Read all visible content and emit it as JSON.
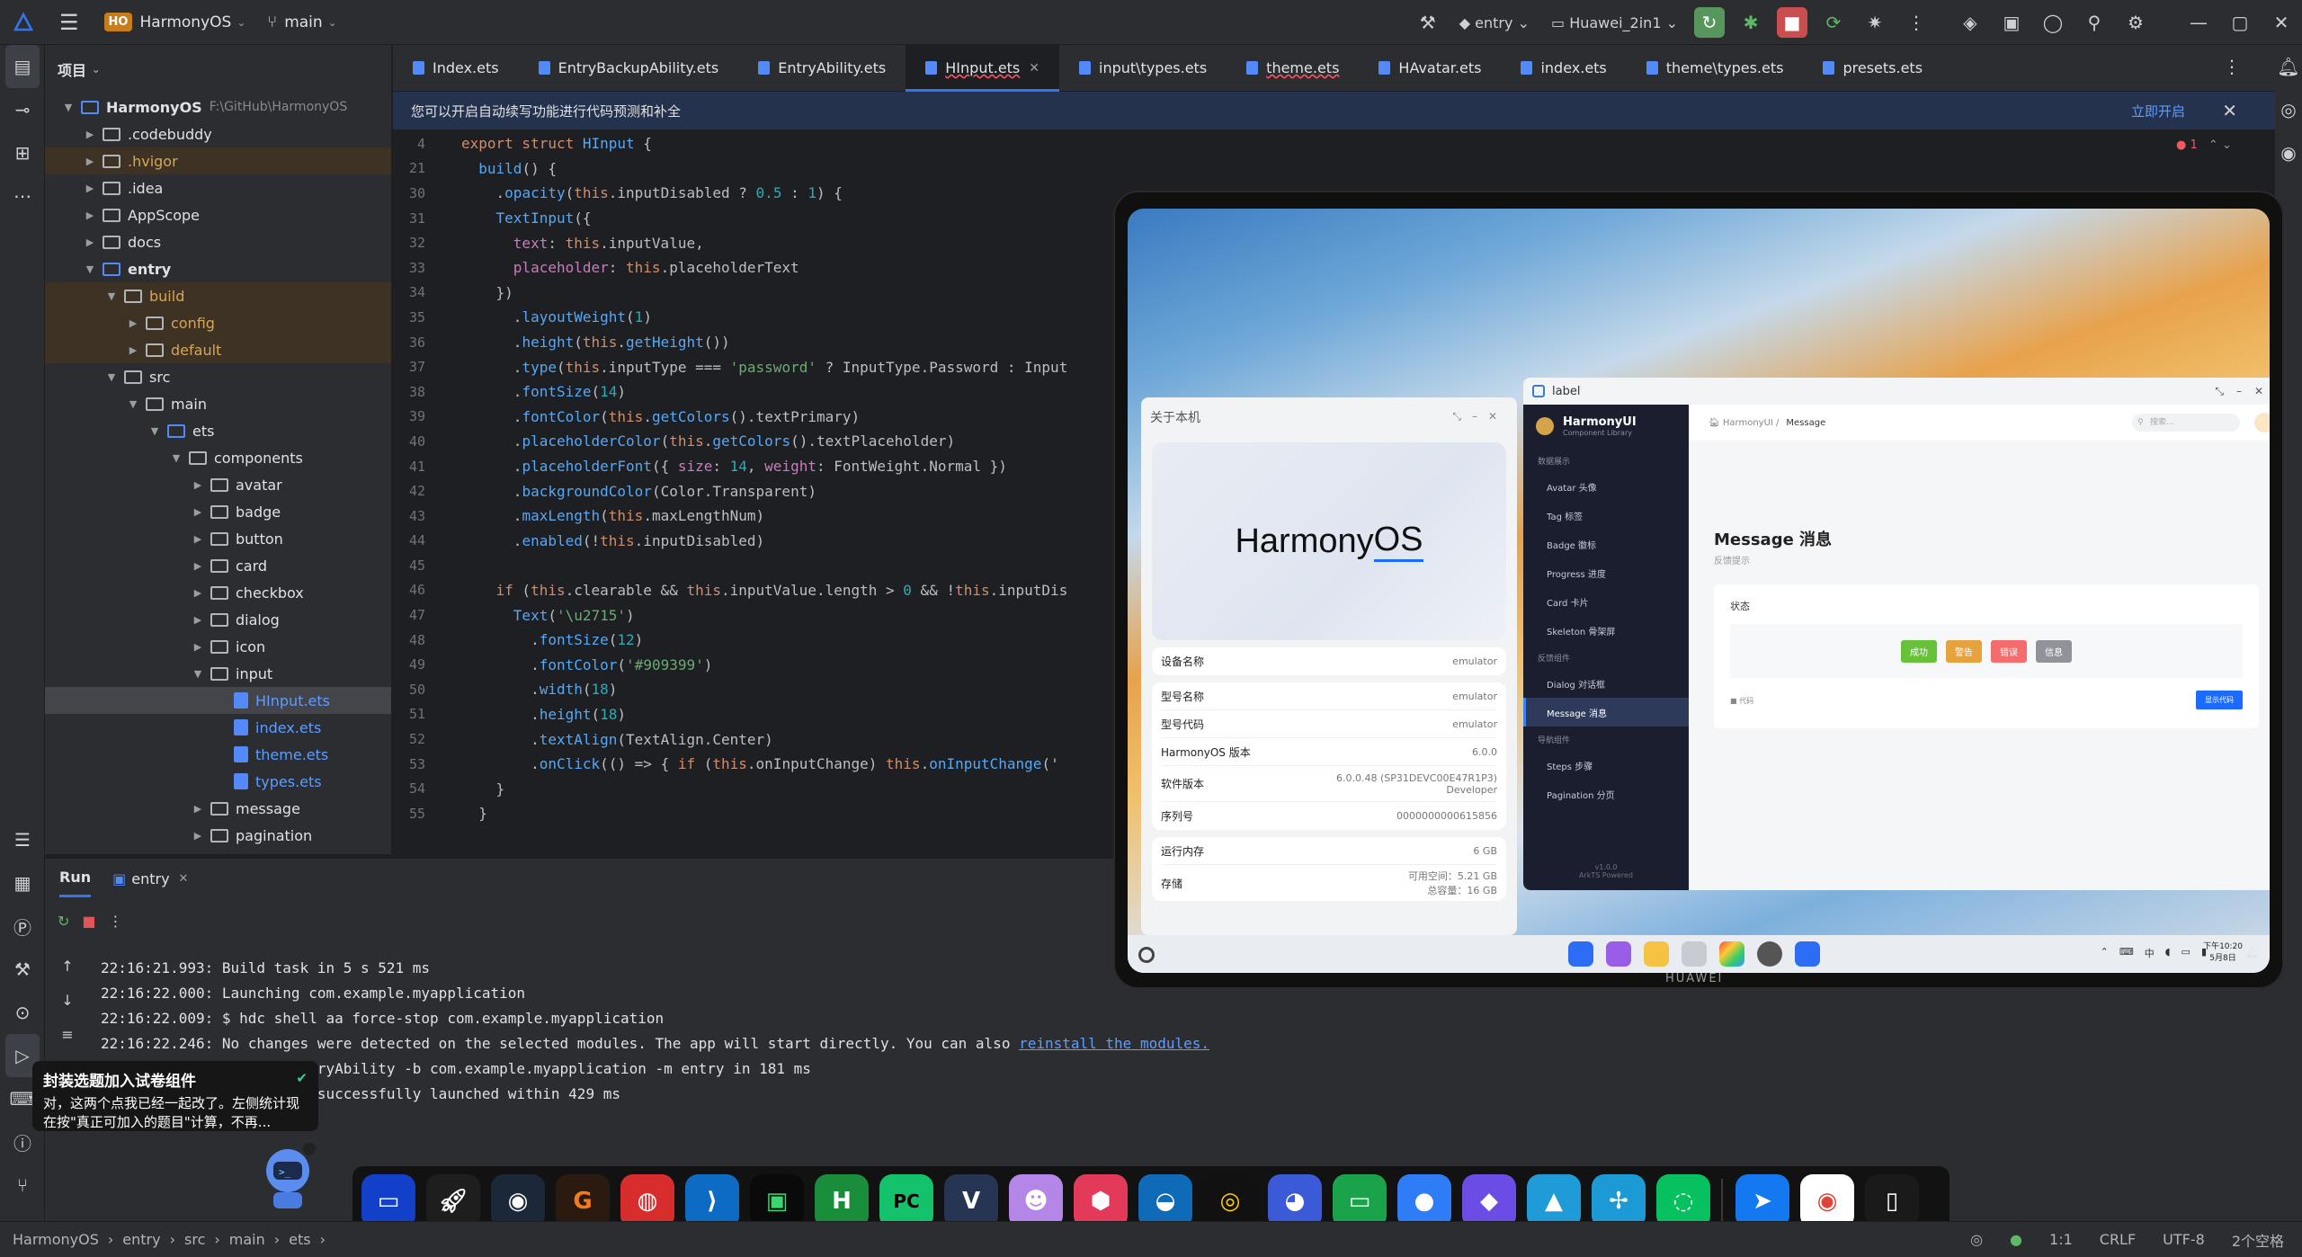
{
  "titlebar": {
    "project_badge": "HO",
    "project_name": "HarmonyOS",
    "branch": "main",
    "run_config": "entry",
    "device": "Huawei_2in1"
  },
  "project_panel": {
    "title": "项目",
    "root_name": "HarmonyOS",
    "root_path": "F:\\GitHub\\HarmonyOS",
    "tree": [
      {
        "label": ".codebuddy",
        "depth": 1,
        "type": "folder"
      },
      {
        "label": ".hvigor",
        "depth": 1,
        "type": "folder",
        "excluded": true
      },
      {
        "label": ".idea",
        "depth": 1,
        "type": "folder"
      },
      {
        "label": "AppScope",
        "depth": 1,
        "type": "folder"
      },
      {
        "label": "docs",
        "depth": 1,
        "type": "folder"
      },
      {
        "label": "entry",
        "depth": 1,
        "type": "module",
        "expanded": true
      },
      {
        "label": "build",
        "depth": 2,
        "type": "folder",
        "excluded": true,
        "expanded": true
      },
      {
        "label": "config",
        "depth": 3,
        "type": "folder",
        "excluded": true
      },
      {
        "label": "default",
        "depth": 3,
        "type": "folder",
        "excluded": true
      },
      {
        "label": "src",
        "depth": 2,
        "type": "folder",
        "expanded": true
      },
      {
        "label": "main",
        "depth": 3,
        "type": "folder",
        "expanded": true
      },
      {
        "label": "ets",
        "depth": 4,
        "type": "srcfolder",
        "expanded": true
      },
      {
        "label": "components",
        "depth": 5,
        "type": "folder",
        "expanded": true
      },
      {
        "label": "avatar",
        "depth": 6,
        "type": "folder"
      },
      {
        "label": "badge",
        "depth": 6,
        "type": "folder"
      },
      {
        "label": "button",
        "depth": 6,
        "type": "folder"
      },
      {
        "label": "card",
        "depth": 6,
        "type": "folder"
      },
      {
        "label": "checkbox",
        "depth": 6,
        "type": "folder"
      },
      {
        "label": "dialog",
        "depth": 6,
        "type": "folder"
      },
      {
        "label": "icon",
        "depth": 6,
        "type": "folder"
      },
      {
        "label": "input",
        "depth": 6,
        "type": "folder",
        "expanded": true
      },
      {
        "label": "HInput.ets",
        "depth": 7,
        "type": "file",
        "selected": true
      },
      {
        "label": "index.ets",
        "depth": 7,
        "type": "file"
      },
      {
        "label": "theme.ets",
        "depth": 7,
        "type": "file"
      },
      {
        "label": "types.ets",
        "depth": 7,
        "type": "file"
      },
      {
        "label": "message",
        "depth": 6,
        "type": "folder"
      },
      {
        "label": "pagination",
        "depth": 6,
        "type": "folder"
      }
    ]
  },
  "tabs": [
    {
      "label": "Index.ets"
    },
    {
      "label": "EntryBackupAbility.ets"
    },
    {
      "label": "EntryAbility.ets"
    },
    {
      "label": "HInput.ets",
      "active": true,
      "error": true
    },
    {
      "label": "input\\types.ets"
    },
    {
      "label": "theme.ets",
      "error": true
    },
    {
      "label": "HAvatar.ets"
    },
    {
      "label": "index.ets"
    },
    {
      "label": "theme\\types.ets"
    },
    {
      "label": "presets.ets"
    }
  ],
  "banner": {
    "text": "您可以开启自动续写功能进行代码预测和补全",
    "action": "立即开启"
  },
  "editor": {
    "problems": "1",
    "lines": [
      {
        "n": "4",
        "html": "<span class='kw'>export struct</span> <span class='fn'>HInput</span> {"
      },
      {
        "n": "21",
        "html": "  <span class='fn'>build</span>() {"
      },
      {
        "n": "30",
        "html": "    .<span class='fn'>opacity</span>(<span class='kw'>this</span>.inputDisabled ? <span class='num'>0.5</span> : <span class='num'>1</span>) {"
      },
      {
        "n": "31",
        "html": "    <span class='fn'>TextInput</span>({"
      },
      {
        "n": "32",
        "html": "      <span class='prop'>text</span>: <span class='kw'>this</span>.inputValue,"
      },
      {
        "n": "33",
        "html": "      <span class='prop'>placeholder</span>: <span class='kw'>this</span>.placeholderText"
      },
      {
        "n": "34",
        "html": "    })"
      },
      {
        "n": "35",
        "html": "      .<span class='fn'>layoutWeight</span>(<span class='num'>1</span>)"
      },
      {
        "n": "36",
        "html": "      .<span class='fn'>height</span>(<span class='kw'>this</span>.<span class='fn'>getHeight</span>())"
      },
      {
        "n": "37",
        "html": "      .<span class='fn'>type</span>(<span class='kw'>this</span>.inputType === <span class='str'>'password'</span> ? InputType.Password : Input"
      },
      {
        "n": "38",
        "html": "      .<span class='fn'>fontSize</span>(<span class='num'>14</span>)"
      },
      {
        "n": "39",
        "html": "      .<span class='fn'>fontColor</span>(<span class='kw'>this</span>.<span class='fn'>getColors</span>().textPrimary)"
      },
      {
        "n": "40",
        "html": "      .<span class='fn'>placeholderColor</span>(<span class='kw'>this</span>.<span class='fn'>getColors</span>().textPlaceholder)"
      },
      {
        "n": "41",
        "html": "      .<span class='fn'>placeholderFont</span>({ <span class='prop'>size</span>: <span class='num'>14</span>, <span class='prop'>weight</span>: FontWeight.Normal })"
      },
      {
        "n": "42",
        "html": "      .<span class='fn'>backgroundColor</span>(Color.Transparent)"
      },
      {
        "n": "43",
        "html": "      .<span class='fn'>maxLength</span>(<span class='kw'>this</span>.maxLengthNum)"
      },
      {
        "n": "44",
        "html": "      .<span class='fn'>enabled</span>(!<span class='kw'>this</span>.inputDisabled)"
      },
      {
        "n": "45",
        "html": ""
      },
      {
        "n": "46",
        "html": "    <span class='kw'>if</span> (<span class='kw'>this</span>.clearable &amp;&amp; <span class='kw'>this</span>.inputValue.length &gt; <span class='num'>0</span> &amp;&amp; !<span class='kw'>this</span>.inputDis"
      },
      {
        "n": "47",
        "html": "      <span class='fn'>Text</span>(<span class='str'>'\\u2715'</span>)"
      },
      {
        "n": "48",
        "html": "        .<span class='fn'>fontSize</span>(<span class='num'>12</span>)"
      },
      {
        "n": "49",
        "html": "        .<span class='fn'>fontColor</span>(<span class='str'>'#909399'</span>)"
      },
      {
        "n": "50",
        "html": "        .<span class='fn'>width</span>(<span class='num'>18</span>)"
      },
      {
        "n": "51",
        "html": "        .<span class='fn'>height</span>(<span class='num'>18</span>)"
      },
      {
        "n": "52",
        "html": "        .<span class='fn'>textAlign</span>(TextAlign.Center)"
      },
      {
        "n": "53",
        "html": "        .<span class='fn'>onClick</span>(() =&gt; { <span class='kw'>if</span> (<span class='kw'>this</span>.onInputChange) <span class='kw'>this</span>.<span class='fn'>onInputChange</span>('"
      },
      {
        "n": "54",
        "html": "    }"
      },
      {
        "n": "55",
        "html": "  }"
      }
    ]
  },
  "run": {
    "title": "Run",
    "tab": "entry",
    "console": [
      "22:16:21.993: Build task in 5 s 521 ms",
      "22:16:22.000: Launching com.example.myapplication",
      "22:16:22.009: $ hdc shell aa force-stop com.example.myapplication",
      "22:16:22.246: No changes were detected on the selected modules. The app will start directly. You can also ",
      "          aa start -a EntryAbility -b com.example.myapplication -m entry in 181 ms",
      "          .myapplication successfully launched within 429 ms"
    ],
    "link": "reinstall the modules."
  },
  "notification": {
    "title": "封装选题加入试卷组件",
    "body": "对，这两个点我已经一起改了。左侧统计现在按\"真正可加入的题目\"计算，不再..."
  },
  "statusbar": {
    "breadcrumb": [
      "HarmonyOS",
      "entry",
      "src",
      "main",
      "ets"
    ],
    "position": "1:1",
    "line_sep": "CRLF",
    "encoding": "UTF-8",
    "indent": "2个空格"
  },
  "emulator": {
    "brand": "HUAWEI",
    "about": {
      "title": "关于本机",
      "hero_a": "Harmony",
      "hero_b": "OS",
      "rows1": [
        {
          "k": "设备名称",
          "v": "emulator"
        }
      ],
      "rows2": [
        {
          "k": "型号名称",
          "v": "emulator"
        },
        {
          "k": "型号代码",
          "v": "emulator"
        },
        {
          "k": "HarmonyOS 版本",
          "v": "6.0.0"
        },
        {
          "k": "软件版本",
          "v": "6.0.0.48 (SP31DEVC00E47R1P3)\nDeveloper"
        },
        {
          "k": "序列号",
          "v": "0000000000615856"
        }
      ],
      "rows3": [
        {
          "k": "运行内存",
          "v": "6 GB"
        },
        {
          "k": "存储",
          "v": "可用空间：5.21 GB\n总容量：16 GB"
        }
      ]
    },
    "harmonyui": {
      "window_title": "label",
      "brand": "HarmonyUI",
      "brand_sub": "Component Library",
      "groups": [
        {
          "name": "数据展示",
          "items": [
            "Avatar 头像",
            "Tag 标签",
            "Badge 徽标",
            "Progress 进度",
            "Card 卡片",
            "Skeleton 骨架屏"
          ]
        },
        {
          "name": "反馈组件",
          "items": [
            "Dialog 对话框",
            "Message 消息"
          ]
        },
        {
          "name": "导航组件",
          "items": [
            "Steps 步骤",
            "Pagination 分页"
          ]
        }
      ],
      "active_item": "Message 消息",
      "version": "v1.0.0",
      "version_sub": "ArkTS Powered",
      "breadcrumb_root": "HarmonyUI",
      "breadcrumb_current": "Message",
      "search_placeholder": "搜索...",
      "heading": "Message 消息",
      "desc": "反馈提示",
      "card_label": "状态",
      "buttons": [
        {
          "label": "成功",
          "color": "#67c23a"
        },
        {
          "label": "警告",
          "color": "#e6a23c"
        },
        {
          "label": "错误",
          "color": "#f56c6c"
        },
        {
          "label": "信息",
          "color": "#909399"
        }
      ],
      "code_toggle": "代码",
      "show_code": "显示代码"
    },
    "clock_time": "下午10:20",
    "clock_date": "5月8日"
  }
}
